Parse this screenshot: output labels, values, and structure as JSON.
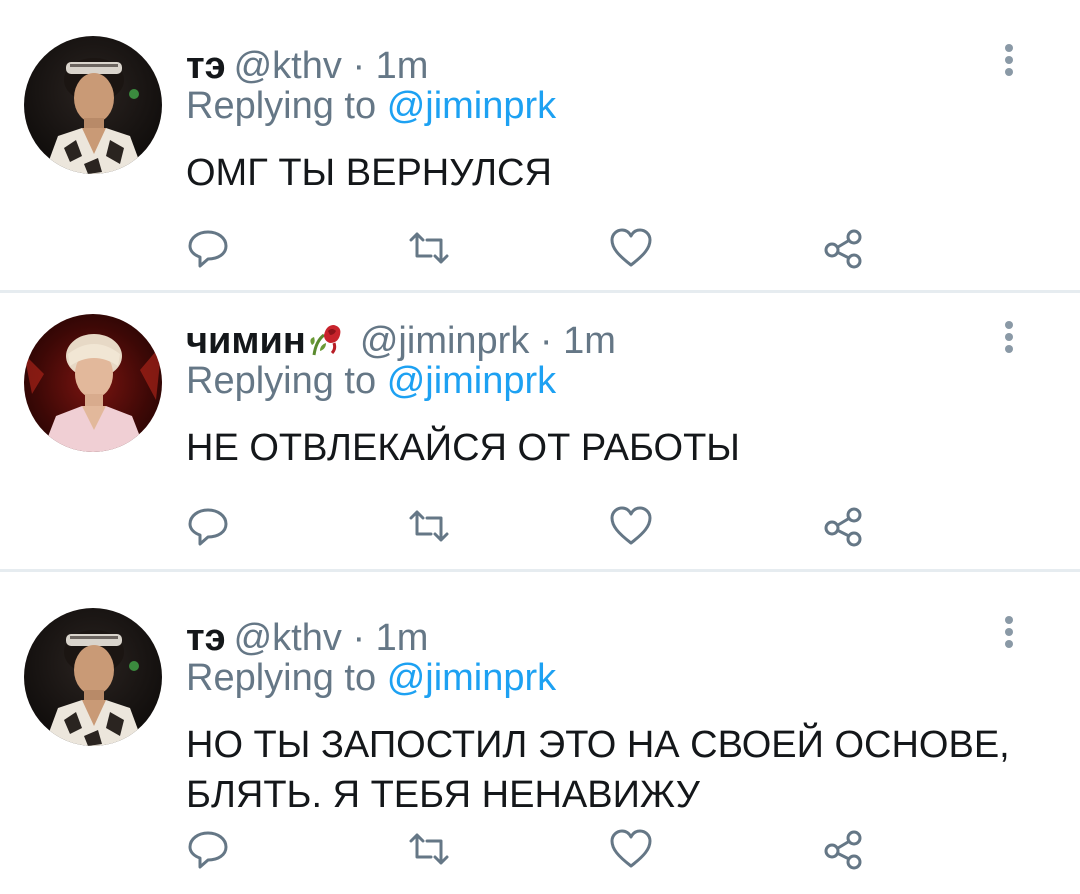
{
  "colors": {
    "name": "#14171a",
    "muted": "#657786",
    "link": "#1da1f2",
    "divider": "#e6ecf0"
  },
  "tweets": [
    {
      "display_name": "тэ",
      "handle": "@kthv",
      "time": "· 1m",
      "reply_label": "Replying to",
      "reply_target": "@jiminprk",
      "text": "ОМГ ТЫ ВЕРНУЛСЯ"
    },
    {
      "display_name": "чимин",
      "name_emoji": "wilted-rose-icon",
      "handle": "@jiminprk",
      "time": "· 1m",
      "reply_label": "Replying to",
      "reply_target": "@jiminprk",
      "text": "НЕ ОТВЛЕКАЙСЯ ОТ РАБОТЫ"
    },
    {
      "display_name": "тэ",
      "handle": "@kthv",
      "time": "· 1m",
      "reply_label": "Replying to",
      "reply_target": "@jiminprk",
      "text": "НО ТЫ ЗАПОСТИЛ ЭТО НА СВОЕЙ ОСНОВЕ, БЛЯТЬ. Я ТЕБЯ НЕНАВИЖУ"
    }
  ],
  "icons": {
    "reply": "reply-icon",
    "retweet": "retweet-icon",
    "like": "like-icon",
    "share": "share-icon",
    "more": "more-vertical-icon"
  }
}
